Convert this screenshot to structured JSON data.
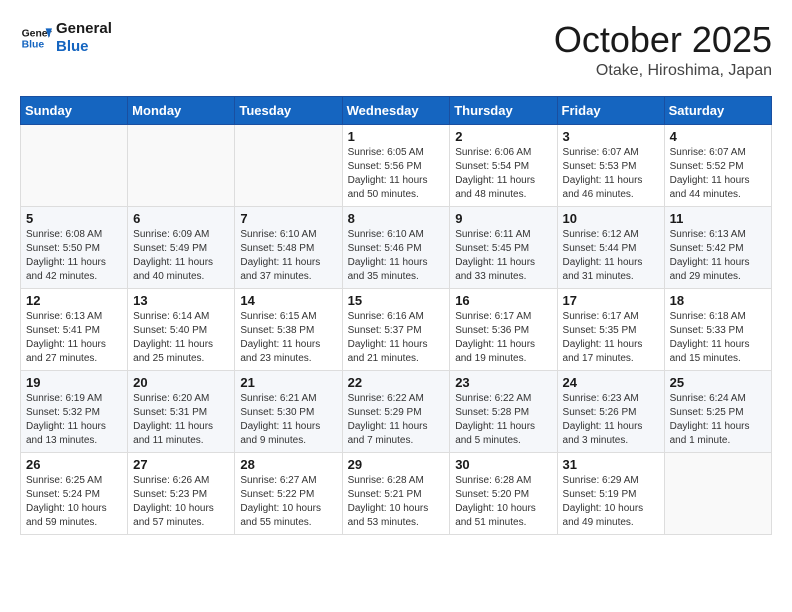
{
  "header": {
    "logo_line1": "General",
    "logo_line2": "Blue",
    "month_title": "October 2025",
    "location": "Otake, Hiroshima, Japan"
  },
  "weekdays": [
    "Sunday",
    "Monday",
    "Tuesday",
    "Wednesday",
    "Thursday",
    "Friday",
    "Saturday"
  ],
  "weeks": [
    [
      {
        "day": "",
        "info": ""
      },
      {
        "day": "",
        "info": ""
      },
      {
        "day": "",
        "info": ""
      },
      {
        "day": "1",
        "info": "Sunrise: 6:05 AM\nSunset: 5:56 PM\nDaylight: 11 hours\nand 50 minutes."
      },
      {
        "day": "2",
        "info": "Sunrise: 6:06 AM\nSunset: 5:54 PM\nDaylight: 11 hours\nand 48 minutes."
      },
      {
        "day": "3",
        "info": "Sunrise: 6:07 AM\nSunset: 5:53 PM\nDaylight: 11 hours\nand 46 minutes."
      },
      {
        "day": "4",
        "info": "Sunrise: 6:07 AM\nSunset: 5:52 PM\nDaylight: 11 hours\nand 44 minutes."
      }
    ],
    [
      {
        "day": "5",
        "info": "Sunrise: 6:08 AM\nSunset: 5:50 PM\nDaylight: 11 hours\nand 42 minutes."
      },
      {
        "day": "6",
        "info": "Sunrise: 6:09 AM\nSunset: 5:49 PM\nDaylight: 11 hours\nand 40 minutes."
      },
      {
        "day": "7",
        "info": "Sunrise: 6:10 AM\nSunset: 5:48 PM\nDaylight: 11 hours\nand 37 minutes."
      },
      {
        "day": "8",
        "info": "Sunrise: 6:10 AM\nSunset: 5:46 PM\nDaylight: 11 hours\nand 35 minutes."
      },
      {
        "day": "9",
        "info": "Sunrise: 6:11 AM\nSunset: 5:45 PM\nDaylight: 11 hours\nand 33 minutes."
      },
      {
        "day": "10",
        "info": "Sunrise: 6:12 AM\nSunset: 5:44 PM\nDaylight: 11 hours\nand 31 minutes."
      },
      {
        "day": "11",
        "info": "Sunrise: 6:13 AM\nSunset: 5:42 PM\nDaylight: 11 hours\nand 29 minutes."
      }
    ],
    [
      {
        "day": "12",
        "info": "Sunrise: 6:13 AM\nSunset: 5:41 PM\nDaylight: 11 hours\nand 27 minutes."
      },
      {
        "day": "13",
        "info": "Sunrise: 6:14 AM\nSunset: 5:40 PM\nDaylight: 11 hours\nand 25 minutes."
      },
      {
        "day": "14",
        "info": "Sunrise: 6:15 AM\nSunset: 5:38 PM\nDaylight: 11 hours\nand 23 minutes."
      },
      {
        "day": "15",
        "info": "Sunrise: 6:16 AM\nSunset: 5:37 PM\nDaylight: 11 hours\nand 21 minutes."
      },
      {
        "day": "16",
        "info": "Sunrise: 6:17 AM\nSunset: 5:36 PM\nDaylight: 11 hours\nand 19 minutes."
      },
      {
        "day": "17",
        "info": "Sunrise: 6:17 AM\nSunset: 5:35 PM\nDaylight: 11 hours\nand 17 minutes."
      },
      {
        "day": "18",
        "info": "Sunrise: 6:18 AM\nSunset: 5:33 PM\nDaylight: 11 hours\nand 15 minutes."
      }
    ],
    [
      {
        "day": "19",
        "info": "Sunrise: 6:19 AM\nSunset: 5:32 PM\nDaylight: 11 hours\nand 13 minutes."
      },
      {
        "day": "20",
        "info": "Sunrise: 6:20 AM\nSunset: 5:31 PM\nDaylight: 11 hours\nand 11 minutes."
      },
      {
        "day": "21",
        "info": "Sunrise: 6:21 AM\nSunset: 5:30 PM\nDaylight: 11 hours\nand 9 minutes."
      },
      {
        "day": "22",
        "info": "Sunrise: 6:22 AM\nSunset: 5:29 PM\nDaylight: 11 hours\nand 7 minutes."
      },
      {
        "day": "23",
        "info": "Sunrise: 6:22 AM\nSunset: 5:28 PM\nDaylight: 11 hours\nand 5 minutes."
      },
      {
        "day": "24",
        "info": "Sunrise: 6:23 AM\nSunset: 5:26 PM\nDaylight: 11 hours\nand 3 minutes."
      },
      {
        "day": "25",
        "info": "Sunrise: 6:24 AM\nSunset: 5:25 PM\nDaylight: 11 hours\nand 1 minute."
      }
    ],
    [
      {
        "day": "26",
        "info": "Sunrise: 6:25 AM\nSunset: 5:24 PM\nDaylight: 10 hours\nand 59 minutes."
      },
      {
        "day": "27",
        "info": "Sunrise: 6:26 AM\nSunset: 5:23 PM\nDaylight: 10 hours\nand 57 minutes."
      },
      {
        "day": "28",
        "info": "Sunrise: 6:27 AM\nSunset: 5:22 PM\nDaylight: 10 hours\nand 55 minutes."
      },
      {
        "day": "29",
        "info": "Sunrise: 6:28 AM\nSunset: 5:21 PM\nDaylight: 10 hours\nand 53 minutes."
      },
      {
        "day": "30",
        "info": "Sunrise: 6:28 AM\nSunset: 5:20 PM\nDaylight: 10 hours\nand 51 minutes."
      },
      {
        "day": "31",
        "info": "Sunrise: 6:29 AM\nSunset: 5:19 PM\nDaylight: 10 hours\nand 49 minutes."
      },
      {
        "day": "",
        "info": ""
      }
    ]
  ]
}
